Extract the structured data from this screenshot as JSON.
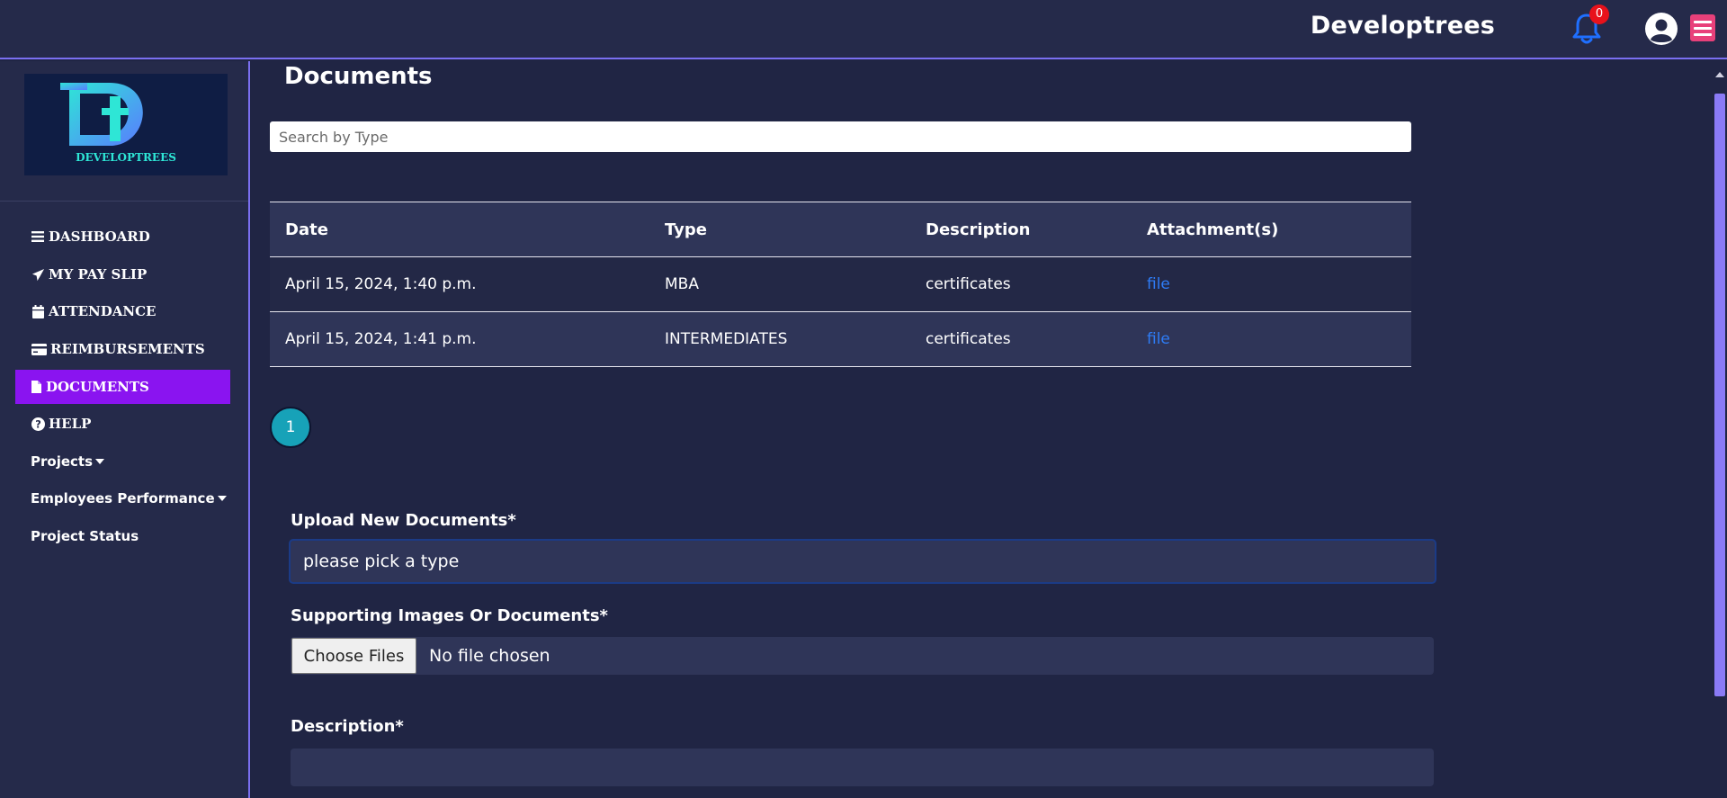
{
  "header": {
    "brand": "Developtrees",
    "notification_count": "0"
  },
  "sidebar": {
    "logo_text": "DEVELOPTREES",
    "items": [
      {
        "label": "DASHBOARD",
        "icon": "bars-icon"
      },
      {
        "label": "MY PAY SLIP",
        "icon": "paper-plane-icon"
      },
      {
        "label": "ATTENDANCE",
        "icon": "calendar-icon"
      },
      {
        "label": "REIMBURSEMENTS",
        "icon": "credit-card-icon"
      },
      {
        "label": "DOCUMENTS",
        "icon": "file-icon",
        "active": true
      },
      {
        "label": "HELP",
        "icon": "question-circle-icon"
      }
    ],
    "extra": [
      {
        "label": "Projects",
        "dropdown": true
      },
      {
        "label": "Employees Performance",
        "dropdown": true
      },
      {
        "label": "Project Status",
        "dropdown": false
      }
    ]
  },
  "main": {
    "title": "Documents",
    "search_placeholder": "Search by Type",
    "table": {
      "headers": [
        "Date",
        "Type",
        "Description",
        "Attachment(s)"
      ],
      "rows": [
        [
          "April 15, 2024, 1:40 p.m.",
          "MBA",
          "certificates",
          "file"
        ],
        [
          "April 15, 2024, 1:41 p.m.",
          "INTERMEDIATES",
          "certificates",
          "file"
        ]
      ]
    },
    "pagination": {
      "current_page": "1"
    },
    "form": {
      "upload_label": "Upload New Documents*",
      "type_select_value": "please pick a type",
      "supporting_label": "Supporting Images Or Documents*",
      "choose_files_label": "Choose Files",
      "no_file_text": "No file chosen",
      "description_label": "Description*"
    }
  },
  "colors": {
    "background": "#202544",
    "panel": "#252a4a",
    "active_nav": "#8a14f0",
    "accent_border": "#7a6ff0",
    "link": "#2e7cf6",
    "pager": "#17a2b8",
    "badge": "#e8121b",
    "menu_button": "#e8407a"
  }
}
